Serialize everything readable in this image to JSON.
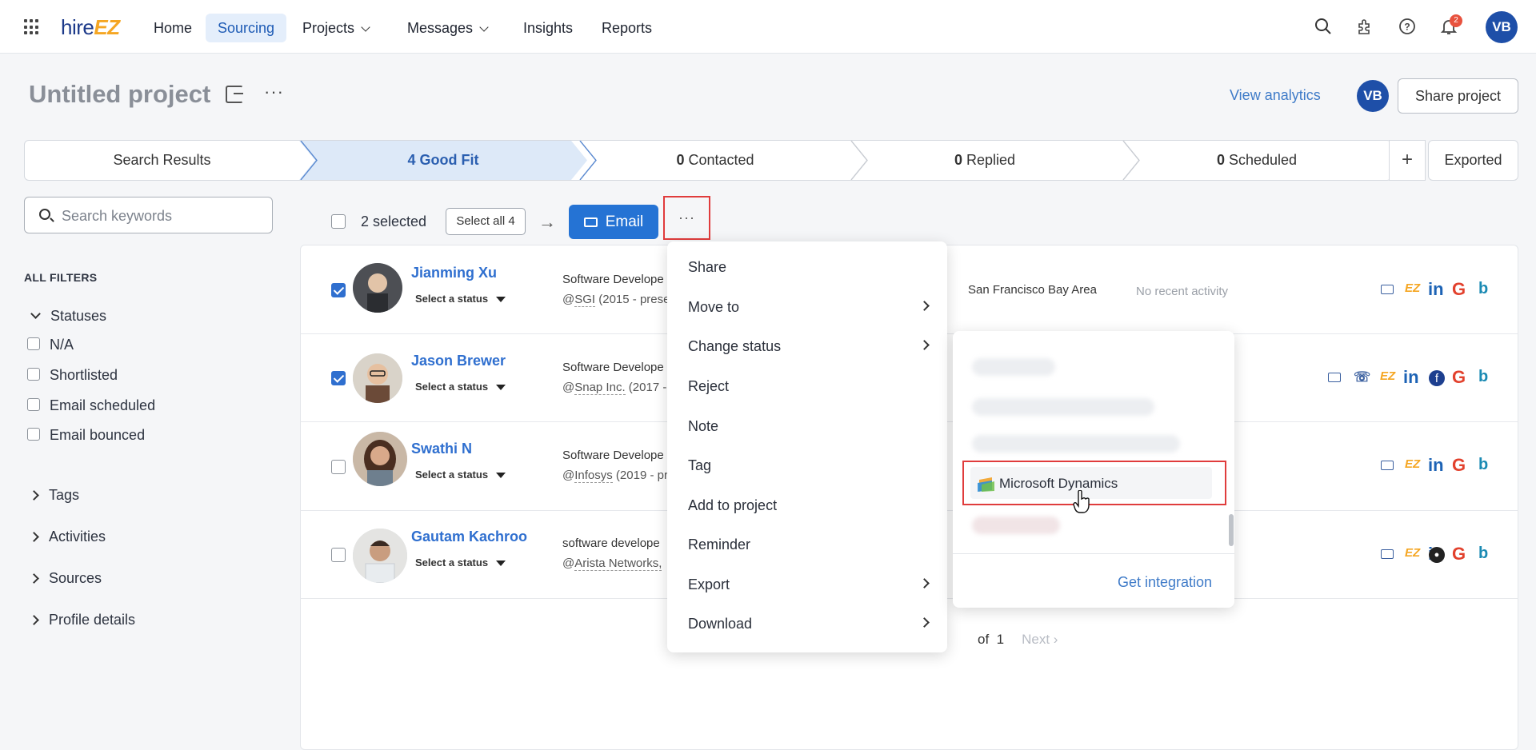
{
  "app": {
    "logo_text": "hire",
    "logo_accent": "EZ",
    "nav": [
      {
        "label": "Home"
      },
      {
        "label": "Sourcing"
      },
      {
        "label": "Projects"
      },
      {
        "label": "Messages"
      },
      {
        "label": "Insights"
      },
      {
        "label": "Reports"
      }
    ],
    "notification_count": "2",
    "user_initials": "VB"
  },
  "project": {
    "title": "Untitled project",
    "more": "···",
    "view_analytics": "View analytics",
    "owner_initials": "VB",
    "share_label": "Share project"
  },
  "stages": [
    {
      "count": "",
      "label": "Search Results"
    },
    {
      "count": "4",
      "label": "Good Fit"
    },
    {
      "count": "0",
      "label": "Contacted"
    },
    {
      "count": "0",
      "label": "Replied"
    },
    {
      "count": "0",
      "label": "Scheduled"
    }
  ],
  "stage_add": "+",
  "stage_exported": "Exported",
  "filters": {
    "search_placeholder": "Search keywords",
    "heading": "ALL FILTERS",
    "statuses_label": "Statuses",
    "status_options": [
      "N/A",
      "Shortlisted",
      "Email scheduled",
      "Email bounced"
    ],
    "collapsed": [
      "Tags",
      "Activities",
      "Sources",
      "Profile details"
    ]
  },
  "toolbar": {
    "selected_text": "2 selected",
    "select_all": "Select all 4",
    "arrow": "→",
    "email": "Email",
    "more": "···"
  },
  "candidates": [
    {
      "name": "Jianming Xu",
      "status": "Select a status",
      "title": "Software Develope",
      "co_at": "@",
      "company": "SGI",
      "years": " (2015 - prese",
      "checked": true,
      "location": "San Francisco Bay Area",
      "activity": "No recent activity"
    },
    {
      "name": "Jason Brewer",
      "status": "Select a status",
      "title": "Software Develope",
      "co_at": "@",
      "company": "Snap Inc.",
      "years": " (2017 -",
      "checked": true
    },
    {
      "name": "Swathi N",
      "status": "Select a status",
      "title": "Software Develope",
      "co_at": "@",
      "company": "Infosys",
      "years": " (2019 - pr",
      "checked": false
    },
    {
      "name": "Gautam Kachroo",
      "status": "Select a status",
      "title": "software develope",
      "co_at": "@",
      "company": "Arista Networks,",
      "years": "",
      "checked": false
    }
  ],
  "social": {
    "ez": "EZ",
    "in": "in",
    "g": "G",
    "b": "b",
    "fb": "f"
  },
  "pagination": {
    "of_text": "of",
    "total": "1",
    "next": "Next"
  },
  "more_menu": [
    {
      "label": "Share",
      "has_sub": false
    },
    {
      "label": "Move to",
      "has_sub": true
    },
    {
      "label": "Change status",
      "has_sub": true
    },
    {
      "label": "Reject",
      "has_sub": false
    },
    {
      "label": "Note",
      "has_sub": false
    },
    {
      "label": "Tag",
      "has_sub": false
    },
    {
      "label": "Add to project",
      "has_sub": false
    },
    {
      "label": "Reminder",
      "has_sub": false
    },
    {
      "label": "Export",
      "has_sub": true
    },
    {
      "label": "Download",
      "has_sub": true
    }
  ],
  "export_submenu": {
    "highlighted": "Microsoft Dynamics",
    "get_integration": "Get integration"
  },
  "colors": {
    "accent": "#2573d4",
    "brand": "#1e4fa8",
    "highlight_border": "#e03c3c",
    "logo_accent": "#f5a623"
  }
}
